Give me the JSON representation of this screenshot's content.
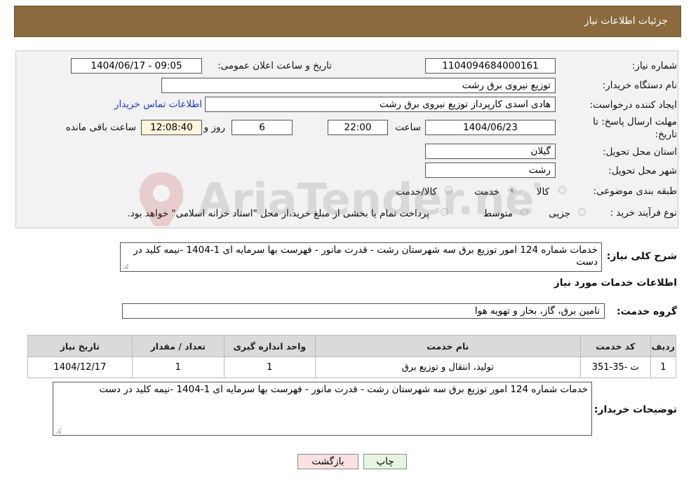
{
  "header": {
    "title": "جزئیات اطلاعات نیاز"
  },
  "form": {
    "need_number_label": "شماره نیاز:",
    "need_number": "1104094684000161",
    "announce_label": "تاریخ و ساعت اعلان عمومی:",
    "announce_value": "1404/06/17 - 09:05",
    "buyer_name_label": "نام دستگاه خریدار:",
    "buyer_name": "توزیع نیروی برق رشت",
    "creator_label": "ایجاد کننده درخواست:",
    "creator": "هادی  اسدی کارپرداز توزیع نیروی برق رشت",
    "contact_link": "اطلاعات تماس خریدار",
    "deadline_label_1": "مهلت ارسال پاسخ: تا",
    "deadline_label_2": "تاریخ:",
    "deadline_date": "1404/06/23",
    "time_label": "ساعت",
    "deadline_time": "22:00",
    "days_value": "6",
    "days_label": "روز و",
    "remaining_time": "12:08:40",
    "remaining_label": "ساعت باقی مانده",
    "province_label": "استان محل تحویل:",
    "province": "گیلان",
    "city_label": "شهر محل تحویل:",
    "city": "رشت",
    "category_label": "طبقه بندی موضوعی:",
    "category_options": [
      "کالا",
      "خدمت",
      "کالا/خدمت"
    ],
    "category_selected": "خدمت",
    "process_label": "نوع فرآیند خرید :",
    "process_options": [
      "جزیی",
      "متوسط"
    ],
    "process_note": "پرداخت تمام یا بخشی از مبلغ خرید،از محل \"اسناد خزانه اسلامی\" خواهد بود."
  },
  "summary": {
    "label": "شرح کلی نیاز:",
    "text": "خدمات شماره 124 امور توزیع برق سه شهرستان رشت - قدرت مانور - فهرست بها سرمایه ای 1-1404 -نیمه کلید در دست"
  },
  "services_section": {
    "title": "اطلاعات خدمات مورد نیاز",
    "group_label": "گروه خدمت:",
    "group_value": "تامین برق، گاز، بخار و تهویه هوا"
  },
  "table": {
    "headers": [
      "ردیف",
      "کد خدمت",
      "نام خدمت",
      "واحد اندازه گیری",
      "تعداد / مقدار",
      "تاریخ نیاز"
    ],
    "rows": [
      [
        "1",
        "ت -35-351",
        "تولید، انتقال و توزیع برق",
        "1",
        "1",
        "1404/12/17"
      ]
    ]
  },
  "buyer_notes": {
    "label": "توضیحات خریدار:",
    "text": "خدمات شماره 124 امور توزیع برق سه شهرستان رشت - قدرت مانور - فهرست بها سرمایه ای 1-1404 -نیمه کلید در دست"
  },
  "buttons": {
    "print": "چاپ",
    "back": "بازگشت"
  },
  "watermark": {
    "text": "AriaTender.neT"
  }
}
